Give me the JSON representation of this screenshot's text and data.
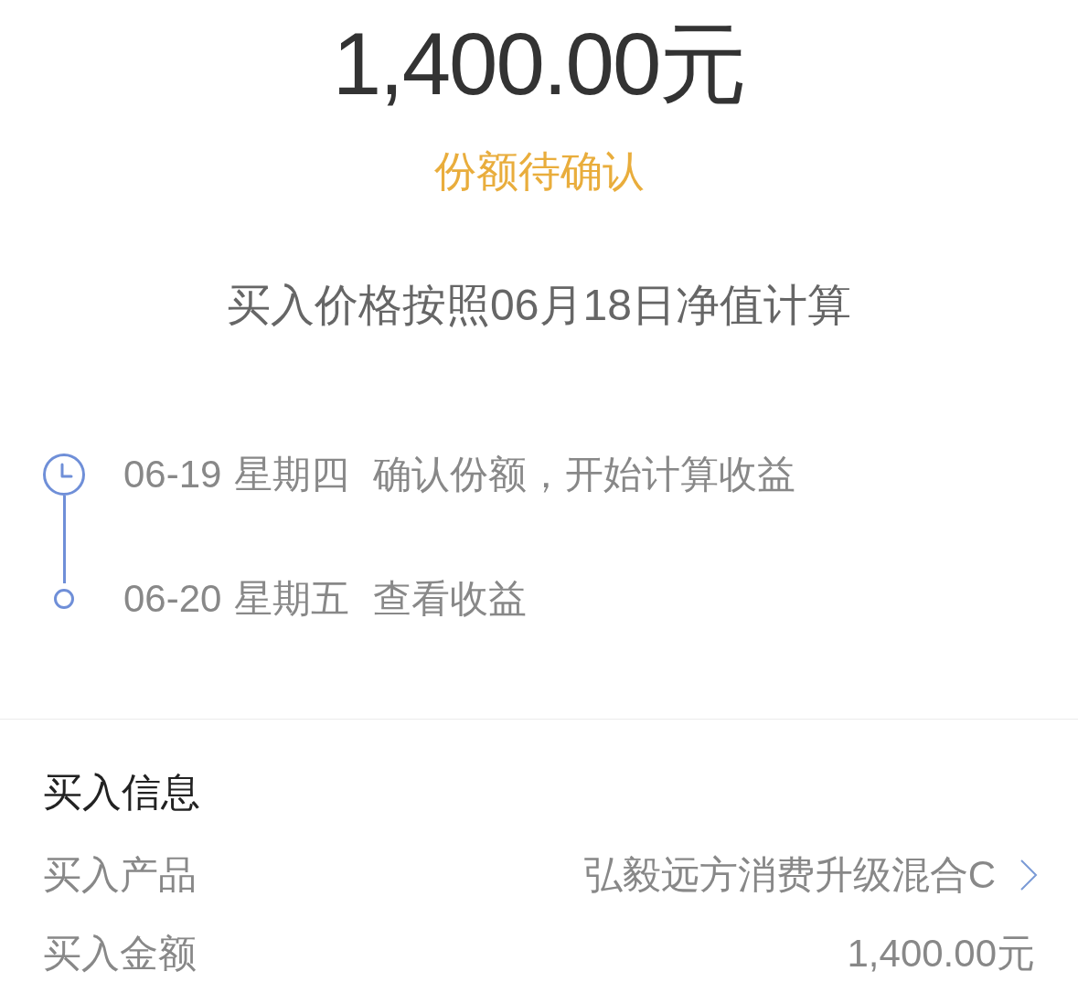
{
  "amount": "1,400.00元",
  "status": "份额待确认",
  "price_note": "买入价格按照06月18日净值计算",
  "timeline": [
    {
      "kind": "clock",
      "date": "06-19",
      "weekday": "星期四",
      "event": "确认份额，开始计算收益"
    },
    {
      "kind": "dot",
      "date": "06-20",
      "weekday": "星期五",
      "event": "查看收益"
    }
  ],
  "purchase_info": {
    "title": "买入信息",
    "rows": [
      {
        "label": "买入产品",
        "value": "弘毅远方消费升级混合C",
        "link": true
      },
      {
        "label": "买入金额",
        "value": "1,400.00元",
        "link": false
      }
    ]
  }
}
